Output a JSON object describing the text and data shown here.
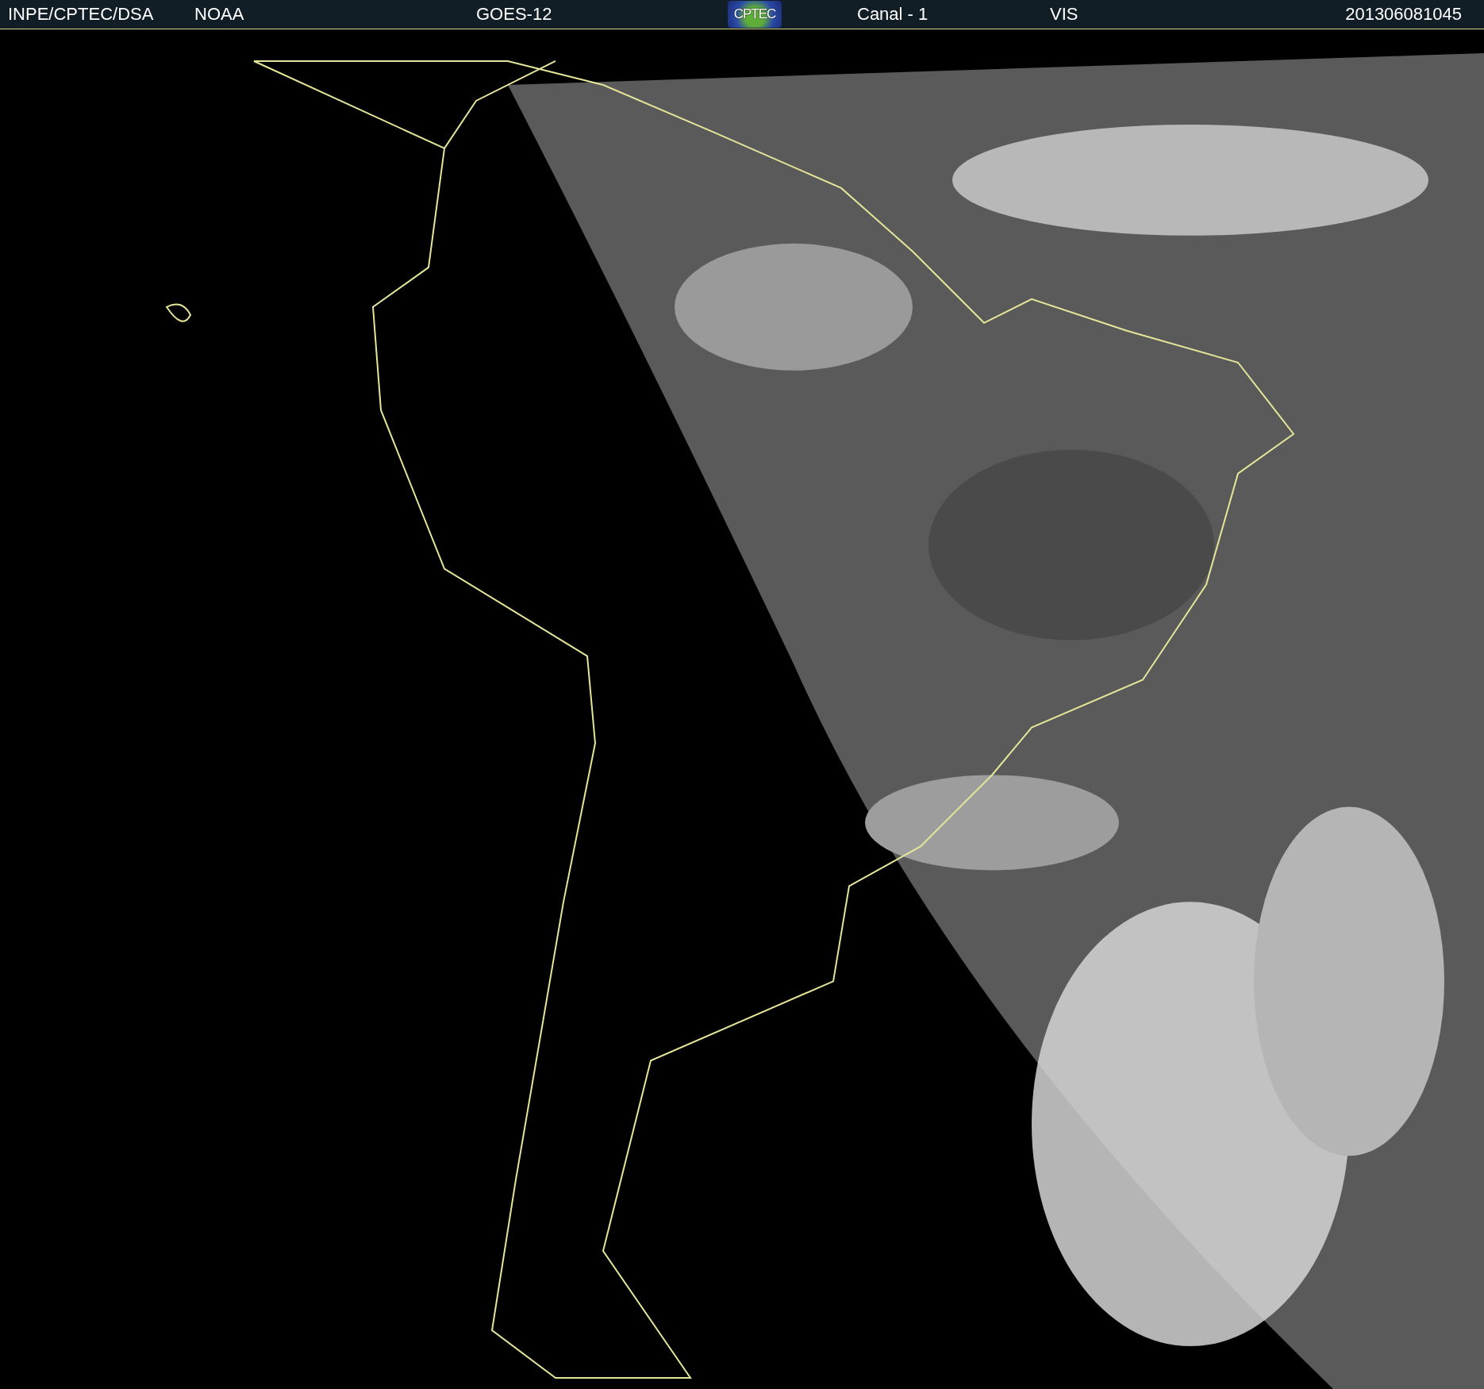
{
  "header": {
    "source": "INPE/CPTEC/DSA",
    "agency": "NOAA",
    "satellite": "GOES-12",
    "logo": "CPTEC",
    "channel": "Canal - 1",
    "band": "VIS",
    "timestamp": "201306081045"
  }
}
